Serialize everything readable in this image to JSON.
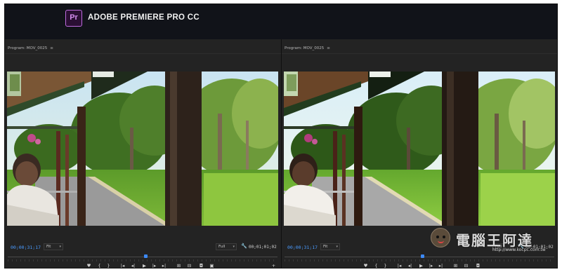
{
  "app": {
    "logo_text": "Pr",
    "title": "ADOBE PREMIERE PRO CC"
  },
  "monitors": [
    {
      "tab_label": "Program: MOV_0025",
      "menu_glyph": "≡",
      "timecode": "00;00;31;17",
      "fit_select": "Fit",
      "quality_select": "Full",
      "duration": "00;01;01;02",
      "playhead_fraction": 0.51,
      "frame_variant": "original"
    },
    {
      "tab_label": "Program: MOV_0025",
      "menu_glyph": "≡",
      "timecode": "00;00;31;17",
      "fit_select": "Fit",
      "quality_select": "Full",
      "duration": "00;01;01;02",
      "playhead_fraction": 0.51,
      "frame_variant": "graded"
    }
  ],
  "transport": {
    "marker": "♥",
    "mark_in": "{",
    "mark_out": "}",
    "go_to_in": "|◂",
    "step_back": "◂|",
    "play": "▶",
    "step_forward": "|▸",
    "go_to_out": "▸|",
    "insert": "⊞",
    "overwrite": "⊟",
    "export_frame": "◘",
    "compare": "▣",
    "add": "+"
  },
  "watermark": {
    "text": "電腦王阿達",
    "url": "http://www.kocpc.com.tw"
  },
  "colors": {
    "accent_timecode": "#4a9bff",
    "playhead": "#3d8af7",
    "logo_border": "#c06be0"
  },
  "icons": [
    "wrench-icon",
    "panel-menu-icon",
    "playhead-icon"
  ]
}
